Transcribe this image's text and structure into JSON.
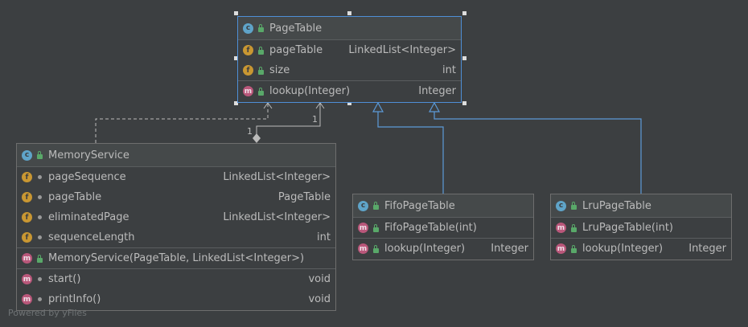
{
  "nodes": {
    "pagetable": {
      "title": "PageTable",
      "kind": "C",
      "fields": [
        {
          "kind": "f",
          "visibility": "public",
          "name": "pageTable",
          "type": "LinkedList<Integer>"
        },
        {
          "kind": "f",
          "visibility": "public",
          "name": "size",
          "type": "int"
        }
      ],
      "methods": [
        {
          "kind": "m",
          "visibility": "public",
          "name": "lookup(Integer)",
          "type": "Integer"
        }
      ]
    },
    "memoryservice": {
      "title": "MemoryService",
      "kind": "C",
      "fields": [
        {
          "kind": "f",
          "visibility": "private",
          "name": "pageSequence",
          "type": "LinkedList<Integer>"
        },
        {
          "kind": "f",
          "visibility": "private",
          "name": "pageTable",
          "type": "PageTable"
        },
        {
          "kind": "f",
          "visibility": "private",
          "name": "eliminatedPage",
          "type": "LinkedList<Integer>"
        },
        {
          "kind": "f",
          "visibility": "private",
          "name": "sequenceLength",
          "type": "int"
        }
      ],
      "constructors": [
        {
          "kind": "m",
          "visibility": "public",
          "name": "MemoryService(PageTable, LinkedList<Integer>)",
          "type": ""
        }
      ],
      "methods": [
        {
          "kind": "m",
          "visibility": "private",
          "name": "start()",
          "type": "void"
        },
        {
          "kind": "m",
          "visibility": "private",
          "name": "printInfo()",
          "type": "void"
        }
      ]
    },
    "fifo": {
      "title": "FifoPageTable",
      "kind": "C",
      "constructors": [
        {
          "kind": "m",
          "visibility": "public",
          "name": "FifoPageTable(int)",
          "type": ""
        }
      ],
      "methods": [
        {
          "kind": "m",
          "visibility": "public",
          "name": "lookup(Integer)",
          "type": "Integer"
        }
      ]
    },
    "lru": {
      "title": "LruPageTable",
      "kind": "C",
      "constructors": [
        {
          "kind": "m",
          "visibility": "public",
          "name": "LruPageTable(int)",
          "type": ""
        }
      ],
      "methods": [
        {
          "kind": "m",
          "visibility": "public",
          "name": "lookup(Integer)",
          "type": "Integer"
        }
      ]
    }
  },
  "edges": {
    "association_label_source": "1",
    "association_label_target": "1"
  },
  "colors": {
    "background": "#3c3f41",
    "inheritance_edge": "#5c9ad8",
    "dependency_edge": "#bbbbbb"
  },
  "watermark": "Powered by yFiles"
}
